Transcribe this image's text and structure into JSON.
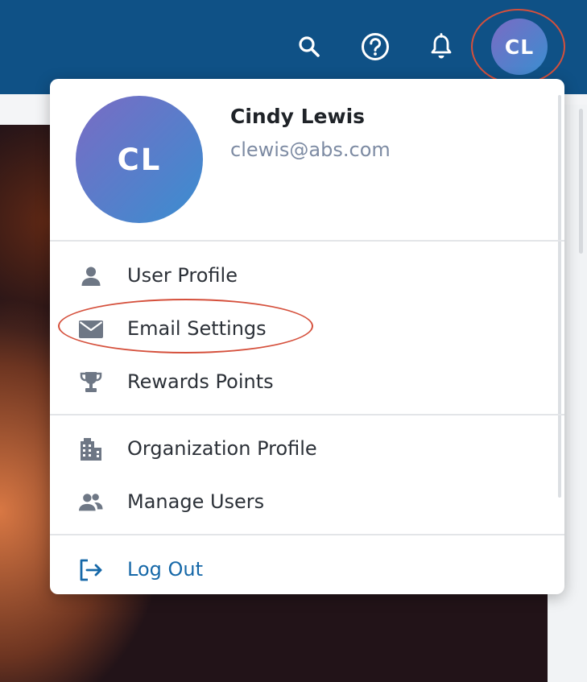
{
  "topbar": {
    "icons": [
      "search-icon",
      "help-icon",
      "bell-icon"
    ],
    "avatar_initials": "CL",
    "color": "#0f5186"
  },
  "user": {
    "initials": "CL",
    "name": "Cindy Lewis",
    "email": "clewis@abs.com"
  },
  "menu": {
    "group1": [
      {
        "label": "User Profile",
        "icon": "person-icon"
      },
      {
        "label": "Email Settings",
        "icon": "envelope-icon"
      },
      {
        "label": "Rewards Points",
        "icon": "trophy-icon"
      }
    ],
    "group2": [
      {
        "label": "Organization Profile",
        "icon": "building-icon"
      },
      {
        "label": "Manage Users",
        "icon": "users-icon"
      }
    ],
    "logout": {
      "label": "Log Out",
      "icon": "logout-icon",
      "color": "#1668a8"
    }
  },
  "annotation_color": "#d5503c"
}
